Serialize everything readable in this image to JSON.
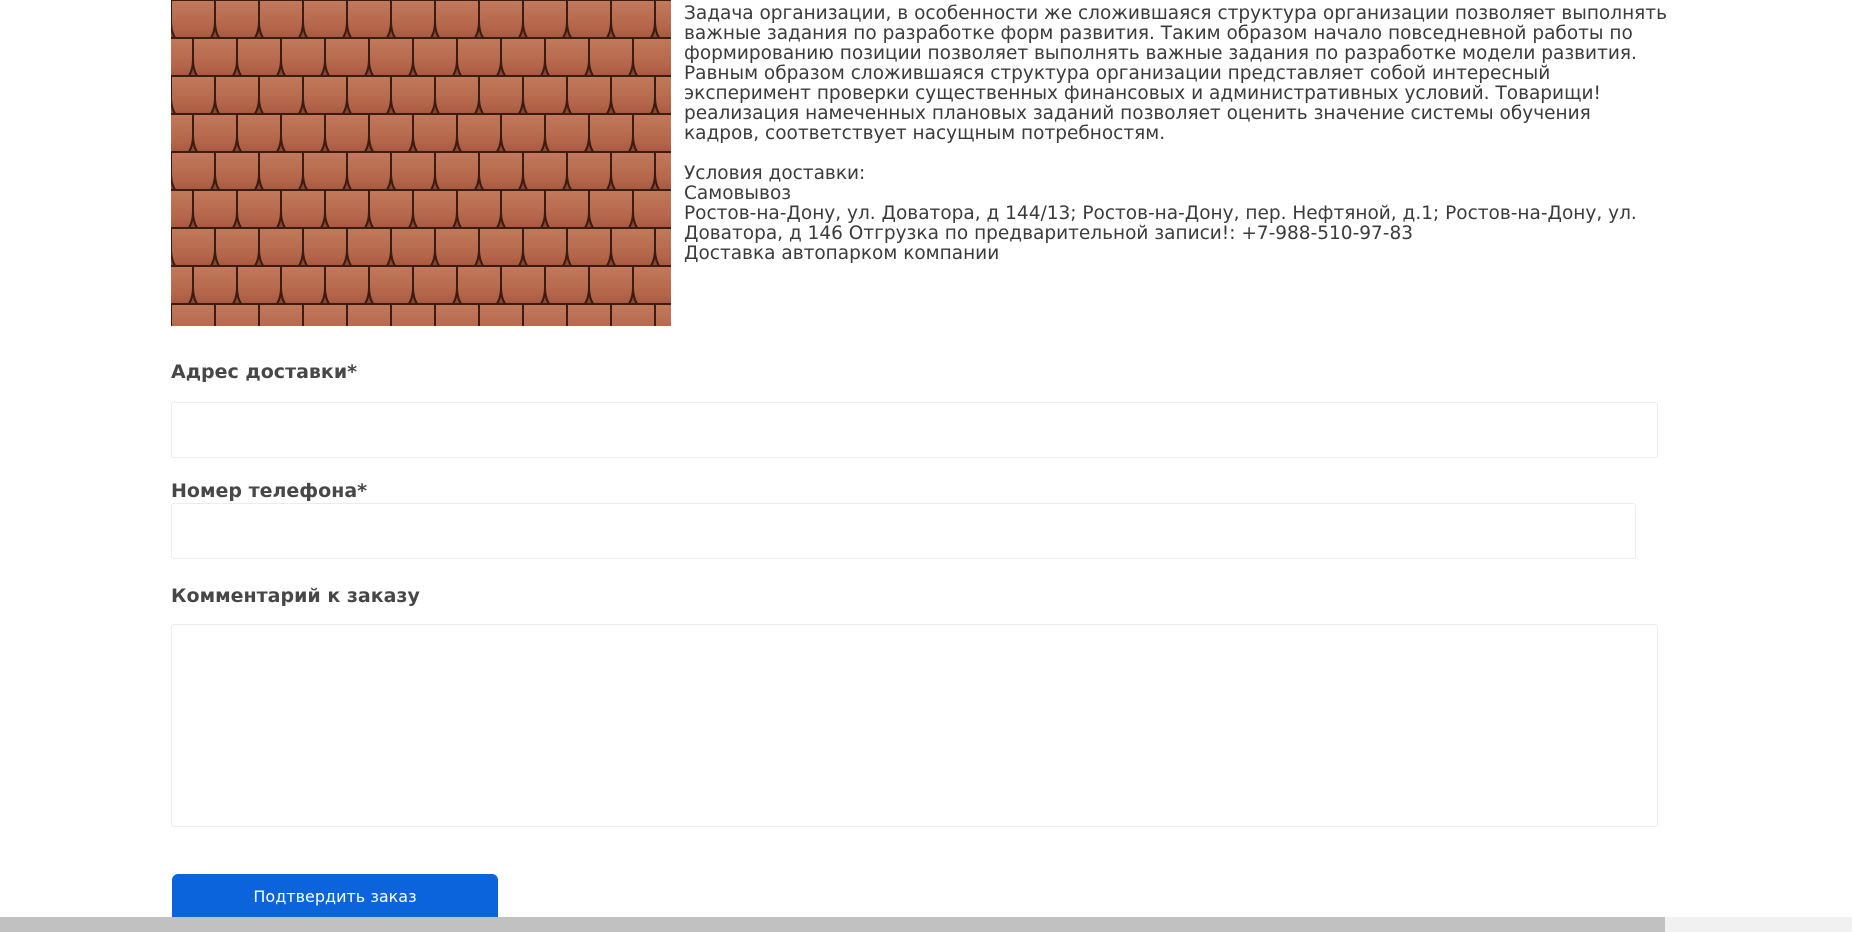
{
  "product": {
    "image_alt": "roof tiles"
  },
  "description": {
    "top_partial_line": "",
    "paragraph_lines": [
      "Задача организации, в особенности же сложившаяся структура организации позволяет выполнять",
      "важные задания по разработке форм развития. Таким образом начало повседневной работы по",
      "формированию позиции позволяет выполнять важные задания по разработке модели развития.",
      "Равным образом сложившаяся структура организации представляет собой интересный",
      "эксперимент проверки существенных финансовых и административных условий. Товарищи!",
      "реализация намеченных плановых заданий позволяет оценить значение системы обучения",
      "кадров, соответствует насущным потребностям."
    ],
    "delivery_heading": "Условия доставки:",
    "delivery_pickup": "Самовывоз",
    "delivery_address_line1": "Ростов-на-Дону, ул. Доватора, д 144/13; Ростов-на-Дону, пер. Нефтяной, д.1; Ростов-на-Дону, ул.",
    "delivery_address_line2": "Доватора, д 146 Отгрузка по предварительной записи!: +7-988-510-97-83",
    "delivery_fleet": "Доставка автопарком компании"
  },
  "form": {
    "address_label": "Адрес доставки*",
    "address_value": "",
    "address_placeholder": "",
    "phone_label": "Номер телефона*",
    "phone_value": "",
    "phone_placeholder": "",
    "comment_label": "Комментарий к заказу",
    "comment_value": "",
    "comment_placeholder": "",
    "submit_label": "Подтвердить заказ"
  },
  "colors": {
    "accent": "#0b64dc",
    "tile": "#b4654a",
    "text": "#3b3b3b",
    "field_border": "#ececec"
  }
}
